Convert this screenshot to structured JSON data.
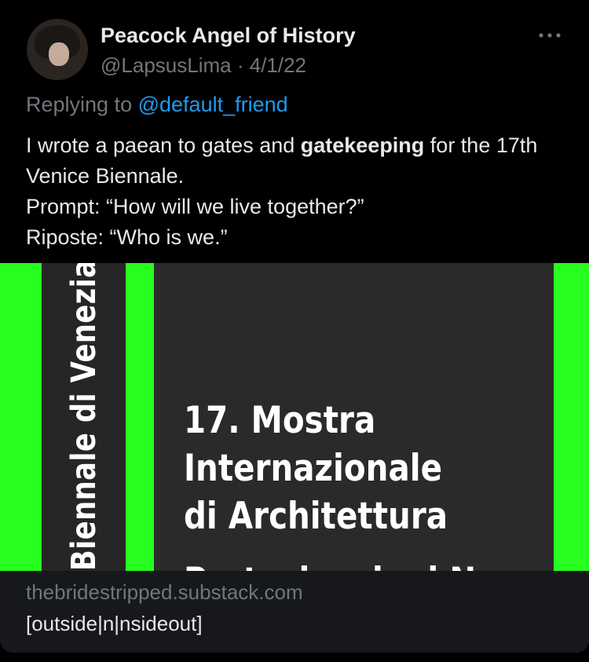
{
  "tweet": {
    "author_name": "Peacock Angel of History",
    "handle": "@LapsusLima",
    "separator": "·",
    "date": "4/1/22",
    "more_icon": "more-icon",
    "replying_prefix": "Replying to",
    "replying_to": "@default_friend",
    "text_before_bold": "I wrote a paean to gates and ",
    "text_bold": "gatekeeping",
    "text_after_bold": " for the 17th Venice Biennale.",
    "line2": "Prompt: “How will we live together?”",
    "line3": "Riposte: “Who is we.”"
  },
  "card": {
    "image": {
      "vertical_text": "Biennale di Venezia",
      "title_line1": "17. Mostra",
      "title_line2": "Internazionale",
      "title_line3": "di Architettura",
      "title_line4": "Partecipazioni Nazionali",
      "colors": {
        "green": "#27ff1e",
        "dark": "#2a2a2a"
      }
    },
    "domain": "thebridestripped.substack.com",
    "title": "[outside|n|nsideout]"
  }
}
